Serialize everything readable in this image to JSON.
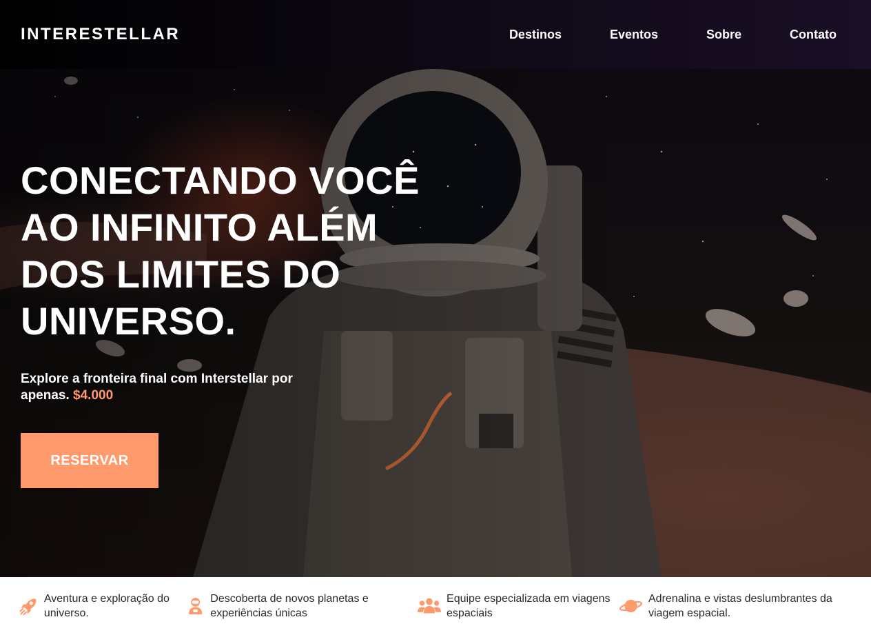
{
  "header": {
    "logo": "INTERESTELLAR",
    "nav": [
      "Destinos",
      "Eventos",
      "Sobre",
      "Contato"
    ]
  },
  "hero": {
    "title": "CONECTANDO VOCÊ AO INFINITO ALÉM DOS LIMITES DO UNIVERSO.",
    "subtitle": "Explore a fronteira final com Interstellar por apenas.",
    "price": "$4.000",
    "cta_label": "RESERVAR"
  },
  "features": [
    {
      "icon": "rocket-icon",
      "text": "Aventura e exploração do universo."
    },
    {
      "icon": "astronaut-icon",
      "text": "Descoberta de novos planetas e experiências únicas"
    },
    {
      "icon": "team-icon",
      "text": "Equipe especializada em viagens espaciais"
    },
    {
      "icon": "planet-icon",
      "text": "Adrenalina e vistas deslumbrantes da viagem espacial."
    }
  ],
  "colors": {
    "accent": "#ff9a6c",
    "header_bg": "#0c0812",
    "text_light": "#ffffff",
    "text_dark": "#2a2a2a"
  }
}
